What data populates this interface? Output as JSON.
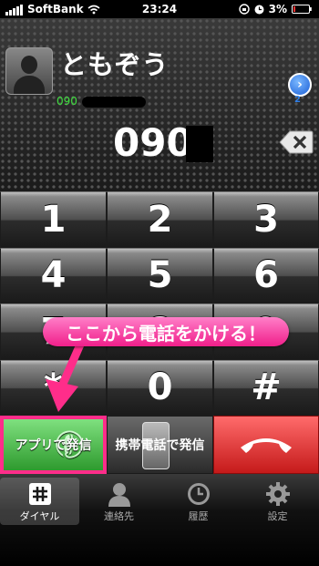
{
  "status_bar": {
    "carrier": "SoftBank",
    "time": "23:24",
    "battery": "3%"
  },
  "contact": {
    "name": "ともぞう",
    "number_prefix": "090"
  },
  "dialed_number": "090",
  "keypad": {
    "keys": [
      "1",
      "2",
      "3",
      "4",
      "5",
      "6",
      "7",
      "8",
      "9",
      "*",
      "0",
      "#"
    ]
  },
  "call_buttons": {
    "app_call_label": "アプリで発信",
    "mobile_call_label": "携帯電話で発信"
  },
  "annotation": {
    "text": "ここから電話をかける！"
  },
  "tabs": [
    {
      "label": "ダイヤル",
      "icon": "keypad-icon"
    },
    {
      "label": "連絡先",
      "icon": "contacts-icon"
    },
    {
      "label": "履歴",
      "icon": "clock-icon"
    },
    {
      "label": "設定",
      "icon": "gear-icon"
    }
  ],
  "page_indicator": "2",
  "colors": {
    "accent_green": "#3fe03f",
    "annotation_pink": "#f01f8a",
    "hangup_red": "#c51a1a",
    "detail_blue": "#1b5fd6"
  }
}
